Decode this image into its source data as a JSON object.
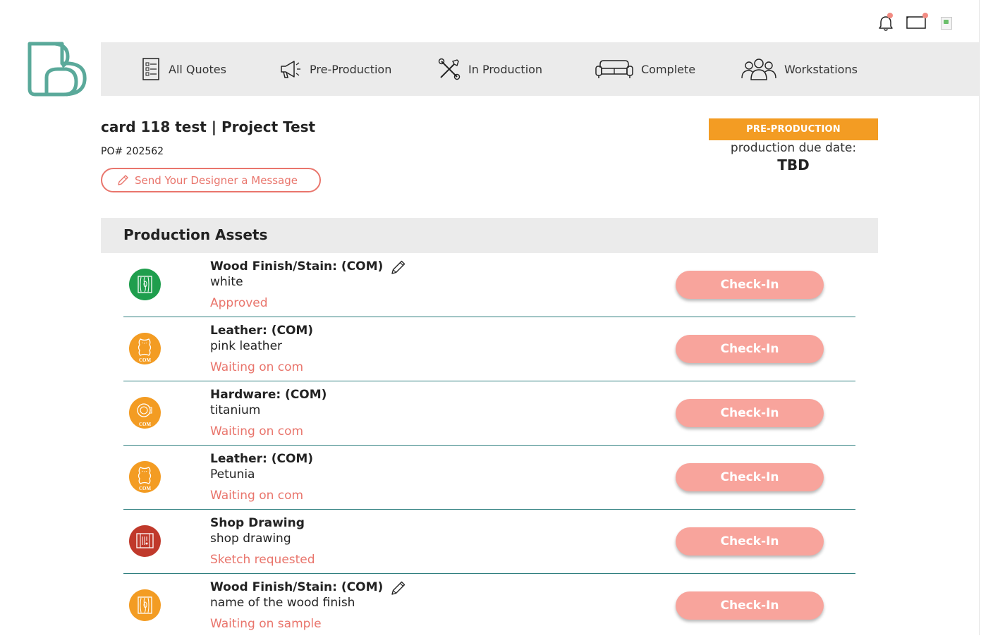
{
  "nav": {
    "items": [
      {
        "label": "All Quotes",
        "icon": "quotes-list-icon"
      },
      {
        "label": "Pre-Production",
        "icon": "megaphone-icon"
      },
      {
        "label": "In Production",
        "icon": "tools-icon"
      },
      {
        "label": "Complete",
        "icon": "sofa-icon"
      },
      {
        "label": "Workstations",
        "icon": "people-group-icon"
      }
    ]
  },
  "header": {
    "title": "card 118 test | Project Test",
    "po": "PO# 202562",
    "message_button": "Send Your Designer a Message",
    "status": "PRE-PRODUCTION",
    "due_label": "production due date:",
    "due_value": "TBD"
  },
  "assets": {
    "title": "Production Assets",
    "checkin_label": "Check-In",
    "items": [
      {
        "name": "Wood Finish/Stain: (COM)",
        "value": "white",
        "status": "Approved",
        "icon": "wood-grain-icon",
        "icon_color": "#1f9e4d",
        "com_tag": "",
        "editable": true
      },
      {
        "name": "Leather: (COM)",
        "value": "pink leather",
        "status": "Waiting on com",
        "icon": "leather-hide-icon",
        "icon_color": "#f39c23",
        "com_tag": "COM",
        "editable": false
      },
      {
        "name": "Hardware: (COM)",
        "value": "titanium",
        "status": "Waiting on com",
        "icon": "hardware-knob-icon",
        "icon_color": "#f39c23",
        "com_tag": "COM",
        "editable": false
      },
      {
        "name": "Leather: (COM)",
        "value": "Petunia",
        "status": "Waiting on com",
        "icon": "leather-hide-icon",
        "icon_color": "#f39c23",
        "com_tag": "COM",
        "editable": false
      },
      {
        "name": "Shop Drawing",
        "value": "shop drawing",
        "status": "Sketch requested",
        "icon": "shop-drawing-icon",
        "icon_color": "#c0392b",
        "com_tag": "",
        "editable": false
      },
      {
        "name": "Wood Finish/Stain: (COM)",
        "value": "name of the wood finish",
        "status": "Waiting on sample",
        "icon": "wood-grain-icon",
        "icon_color": "#f39c23",
        "com_tag": "",
        "editable": true
      }
    ]
  },
  "colors": {
    "accent": "#e9756c",
    "button": "#f8a49c",
    "status_badge": "#f39c23",
    "logo": "#5aa99a",
    "notification_dot": "#f28b82"
  }
}
